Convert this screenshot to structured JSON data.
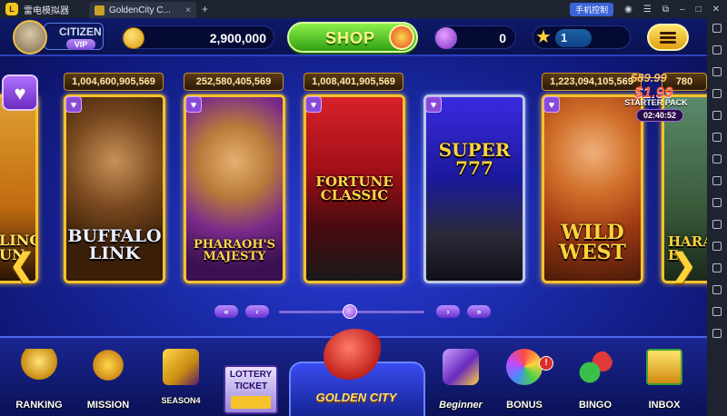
{
  "emulator": {
    "app_name": "雷电模拟器",
    "tab_title": "GoldenCity C...",
    "phone_control": "手机控制",
    "tab_close": "×",
    "tab_add": "+"
  },
  "hud": {
    "vip_title": "CITIZEN",
    "vip_level": "VIP",
    "coins": "2,900,000",
    "shop_label": "SHOP",
    "gems": "0",
    "level": "1"
  },
  "favorite_glyph": "♥",
  "cards": [
    {
      "name": "partial-left",
      "title": "LING\nUN",
      "jackpot": ""
    },
    {
      "name": "buffalo-link",
      "title": "BUFFALO\nLINK",
      "jackpot": "1,004,600,905,569"
    },
    {
      "name": "pharaohs-majesty",
      "title": "PHARAOH'S\nMAJESTY",
      "jackpot": "252,580,405,569"
    },
    {
      "name": "fortune-classic",
      "title": "FORTUNE\nCLASSIC",
      "jackpot": "1,008,401,905,569"
    },
    {
      "name": "super-777",
      "title": "SUPER\n777",
      "jackpot": ""
    },
    {
      "name": "wild-west",
      "title": "WILD\nWEST",
      "jackpot": "1,223,094,105,569"
    },
    {
      "name": "partial-right",
      "title": "HARA\nE",
      "jackpot": "780"
    }
  ],
  "starter_pack": {
    "old_price": "$89.99",
    "new_price": "$1.99",
    "label": "STARTER PACK",
    "timer": "02:40:52"
  },
  "pager": {
    "first": "«",
    "prev": "‹",
    "next": "›",
    "last": "»"
  },
  "arrows": {
    "left": "❮",
    "right": "❯"
  },
  "bottom_nav": {
    "ranking": "RANKING",
    "mission": "MISSION",
    "album": "SEASON4",
    "lottery_line1": "LOTTERY",
    "lottery_line2": "TICKET",
    "golden_city": "GOLDEN CITY",
    "beginner": "Beginner",
    "bonus": "BONUS",
    "bonus_badge": "!",
    "bingo": "BINGO",
    "inbox": "INBOX"
  }
}
